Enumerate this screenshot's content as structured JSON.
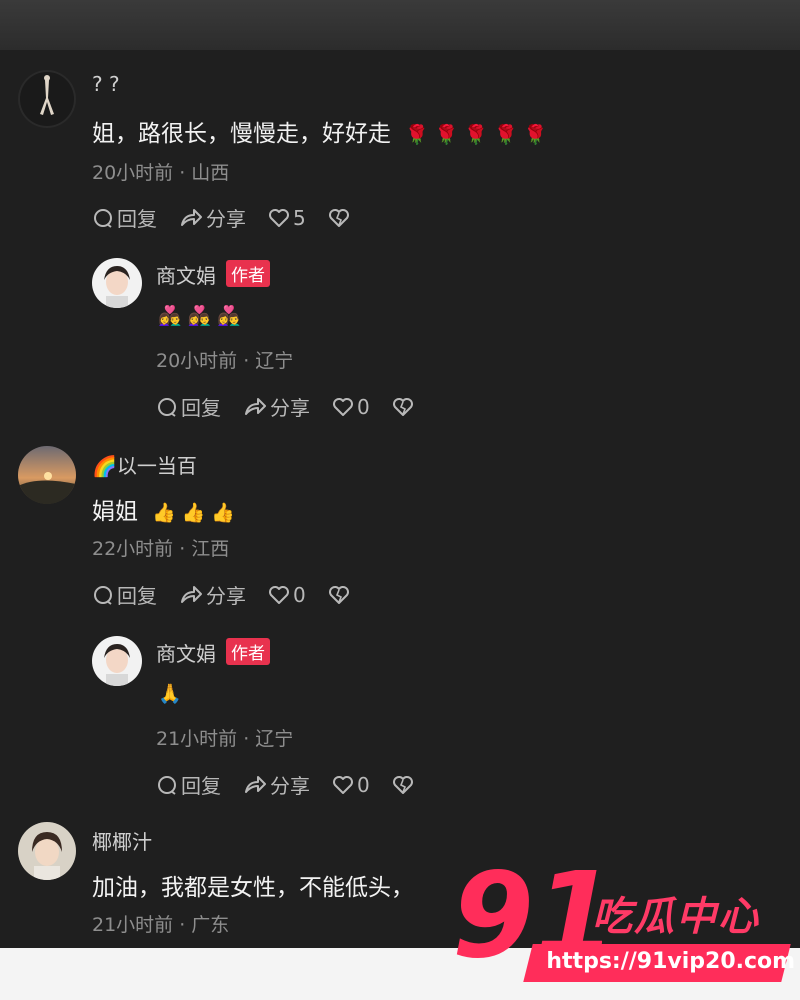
{
  "comments": [
    {
      "name": "? ?",
      "text": "姐，路很长，慢慢走，好好走",
      "emoji": "🌹 🌹 🌹 🌹 🌹",
      "meta": "20小时前 · 山西",
      "reply": "回复",
      "share": "分享",
      "likes": "5"
    },
    {
      "name": "商文娟",
      "badge": "作者",
      "emoji": "👩‍❤️‍👨 👩‍❤️‍👨 👩‍❤️‍👨",
      "meta": "20小时前 · 辽宁",
      "reply": "回复",
      "share": "分享",
      "likes": "0"
    },
    {
      "name": "🌈以一当百",
      "text": "娟姐",
      "emoji": "👍 👍 👍",
      "meta": "22小时前 · 江西",
      "reply": "回复",
      "share": "分享",
      "likes": "0"
    },
    {
      "name": "商文娟",
      "badge": "作者",
      "emoji": "🙏",
      "meta": "21小时前 · 辽宁",
      "reply": "回复",
      "share": "分享",
      "likes": "0"
    },
    {
      "name": "椰椰汁",
      "text": "加油，我都是女性，不能低头，",
      "meta": "21小时前 · 广东"
    }
  ],
  "watermark": {
    "number": "91",
    "title": "吃瓜中心",
    "url": "https://91vip20.com"
  },
  "colors": {
    "background": "#1f1f1f",
    "author_badge": "#e8324e",
    "watermark": "#ff2d5a"
  },
  "icons": [
    "comment-icon",
    "share-icon",
    "heart-icon",
    "broken-heart-icon"
  ]
}
